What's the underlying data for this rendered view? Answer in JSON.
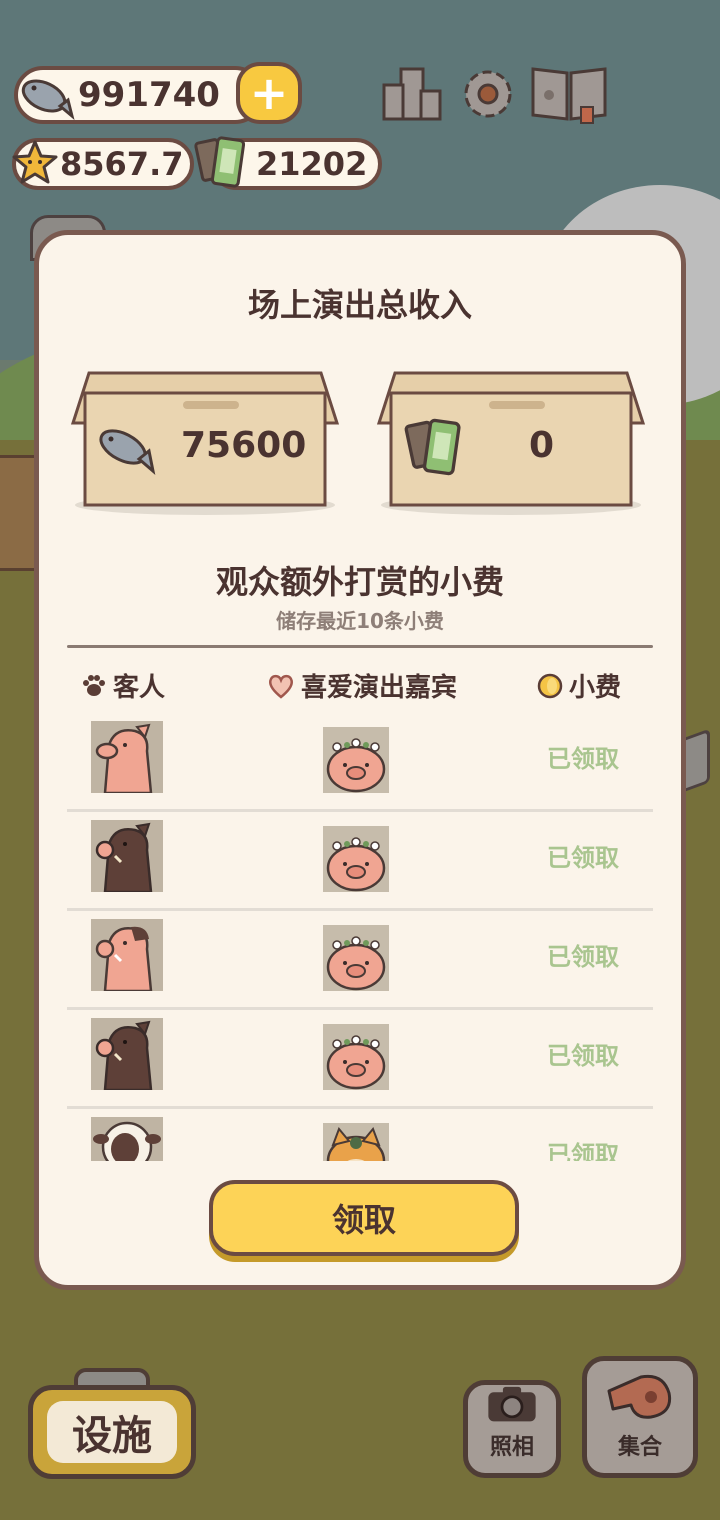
{
  "hud": {
    "fish": "991740",
    "stars": "8567.7",
    "tickets": "21202",
    "add_symbol": "+"
  },
  "top_buttons": [
    {
      "name": "ranking",
      "icon": "podium-icon"
    },
    {
      "name": "settings",
      "icon": "gear-icon"
    },
    {
      "name": "book",
      "icon": "paw-book-icon"
    }
  ],
  "modal": {
    "title": "场上演出总收入",
    "fish_income": "75600",
    "ticket_income": "0",
    "tips_title": "观众额外打赏的小费",
    "tips_caption": "储存最近10条小费",
    "columns": {
      "guest": "客人",
      "favorite": "喜爱演出嘉宾",
      "tip": "小费"
    },
    "rows": [
      {
        "guest": "pink-pig",
        "performer": "flower-pig",
        "status": "已领取"
      },
      {
        "guest": "dark-boar",
        "performer": "flower-pig",
        "status": "已领取"
      },
      {
        "guest": "pink-boar",
        "performer": "flower-pig",
        "status": "已领取"
      },
      {
        "guest": "dark-boar",
        "performer": "flower-pig",
        "status": "已领取"
      },
      {
        "guest": "sheep",
        "performer": "shiba-dog",
        "status": "已领取"
      }
    ],
    "claim_label": "领取"
  },
  "bottom": {
    "facility_label": "设施",
    "photo_label": "照相",
    "gather_label": "集合"
  },
  "colors": {
    "border": "#6b4b42",
    "cream": "#fbf4ea",
    "yellow": "#fdd357",
    "claimed_green": "#a9c58f"
  }
}
